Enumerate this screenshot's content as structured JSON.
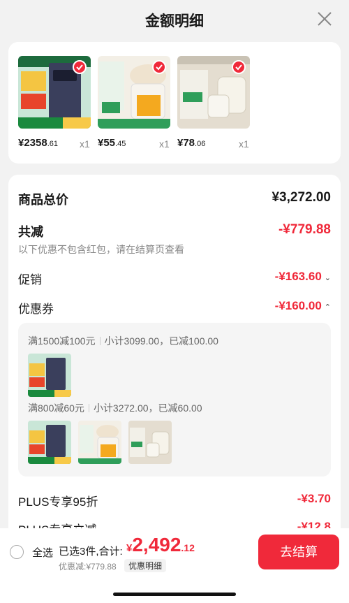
{
  "header": {
    "title": "金额明细"
  },
  "products": [
    {
      "price_int": "¥2358",
      "price_dec": ".61",
      "qty": "x1",
      "icon": "water-heater-image",
      "color": "#3a3f5c"
    },
    {
      "price_int": "¥55",
      "price_dec": ".45",
      "qty": "x1",
      "icon": "food-processor-image",
      "color": "#efe3cf"
    },
    {
      "price_int": "¥78",
      "price_dec": ".06",
      "qty": "x1",
      "icon": "kettle-image",
      "color": "#d9d2c4"
    }
  ],
  "summary": {
    "total_label": "商品总价",
    "total_value": "¥3,272.00",
    "reduce_label": "共减",
    "reduce_value": "-¥779.88",
    "note": "以下优惠不包含红包，请在结算页查看",
    "promo_label": "促销",
    "promo_value": "-¥163.60",
    "coupon_label": "优惠券",
    "coupon_value": "-¥160.00",
    "plus95_label": "PLUS专享95折",
    "plus95_value": "-¥3.70",
    "plusdirect_label": "PLUS专享立减",
    "plusdirect_value": "-¥12.8"
  },
  "coupons": [
    {
      "rule": "满1500减100元",
      "detail": "小计3099.00，已减100.00"
    },
    {
      "rule": "满800减60元",
      "detail": "小计3272.00，已减60.00"
    }
  ],
  "bottom": {
    "select_all": "全选",
    "selected": "已选3件,合计:",
    "currency": "¥",
    "total_int": "2,492",
    "total_dec": ".12",
    "discount": "优惠减:¥779.88",
    "detail_btn": "优惠明细",
    "checkout": "去结算"
  },
  "colors": {
    "accent": "#f0293a",
    "background": "#f2f2f2"
  }
}
